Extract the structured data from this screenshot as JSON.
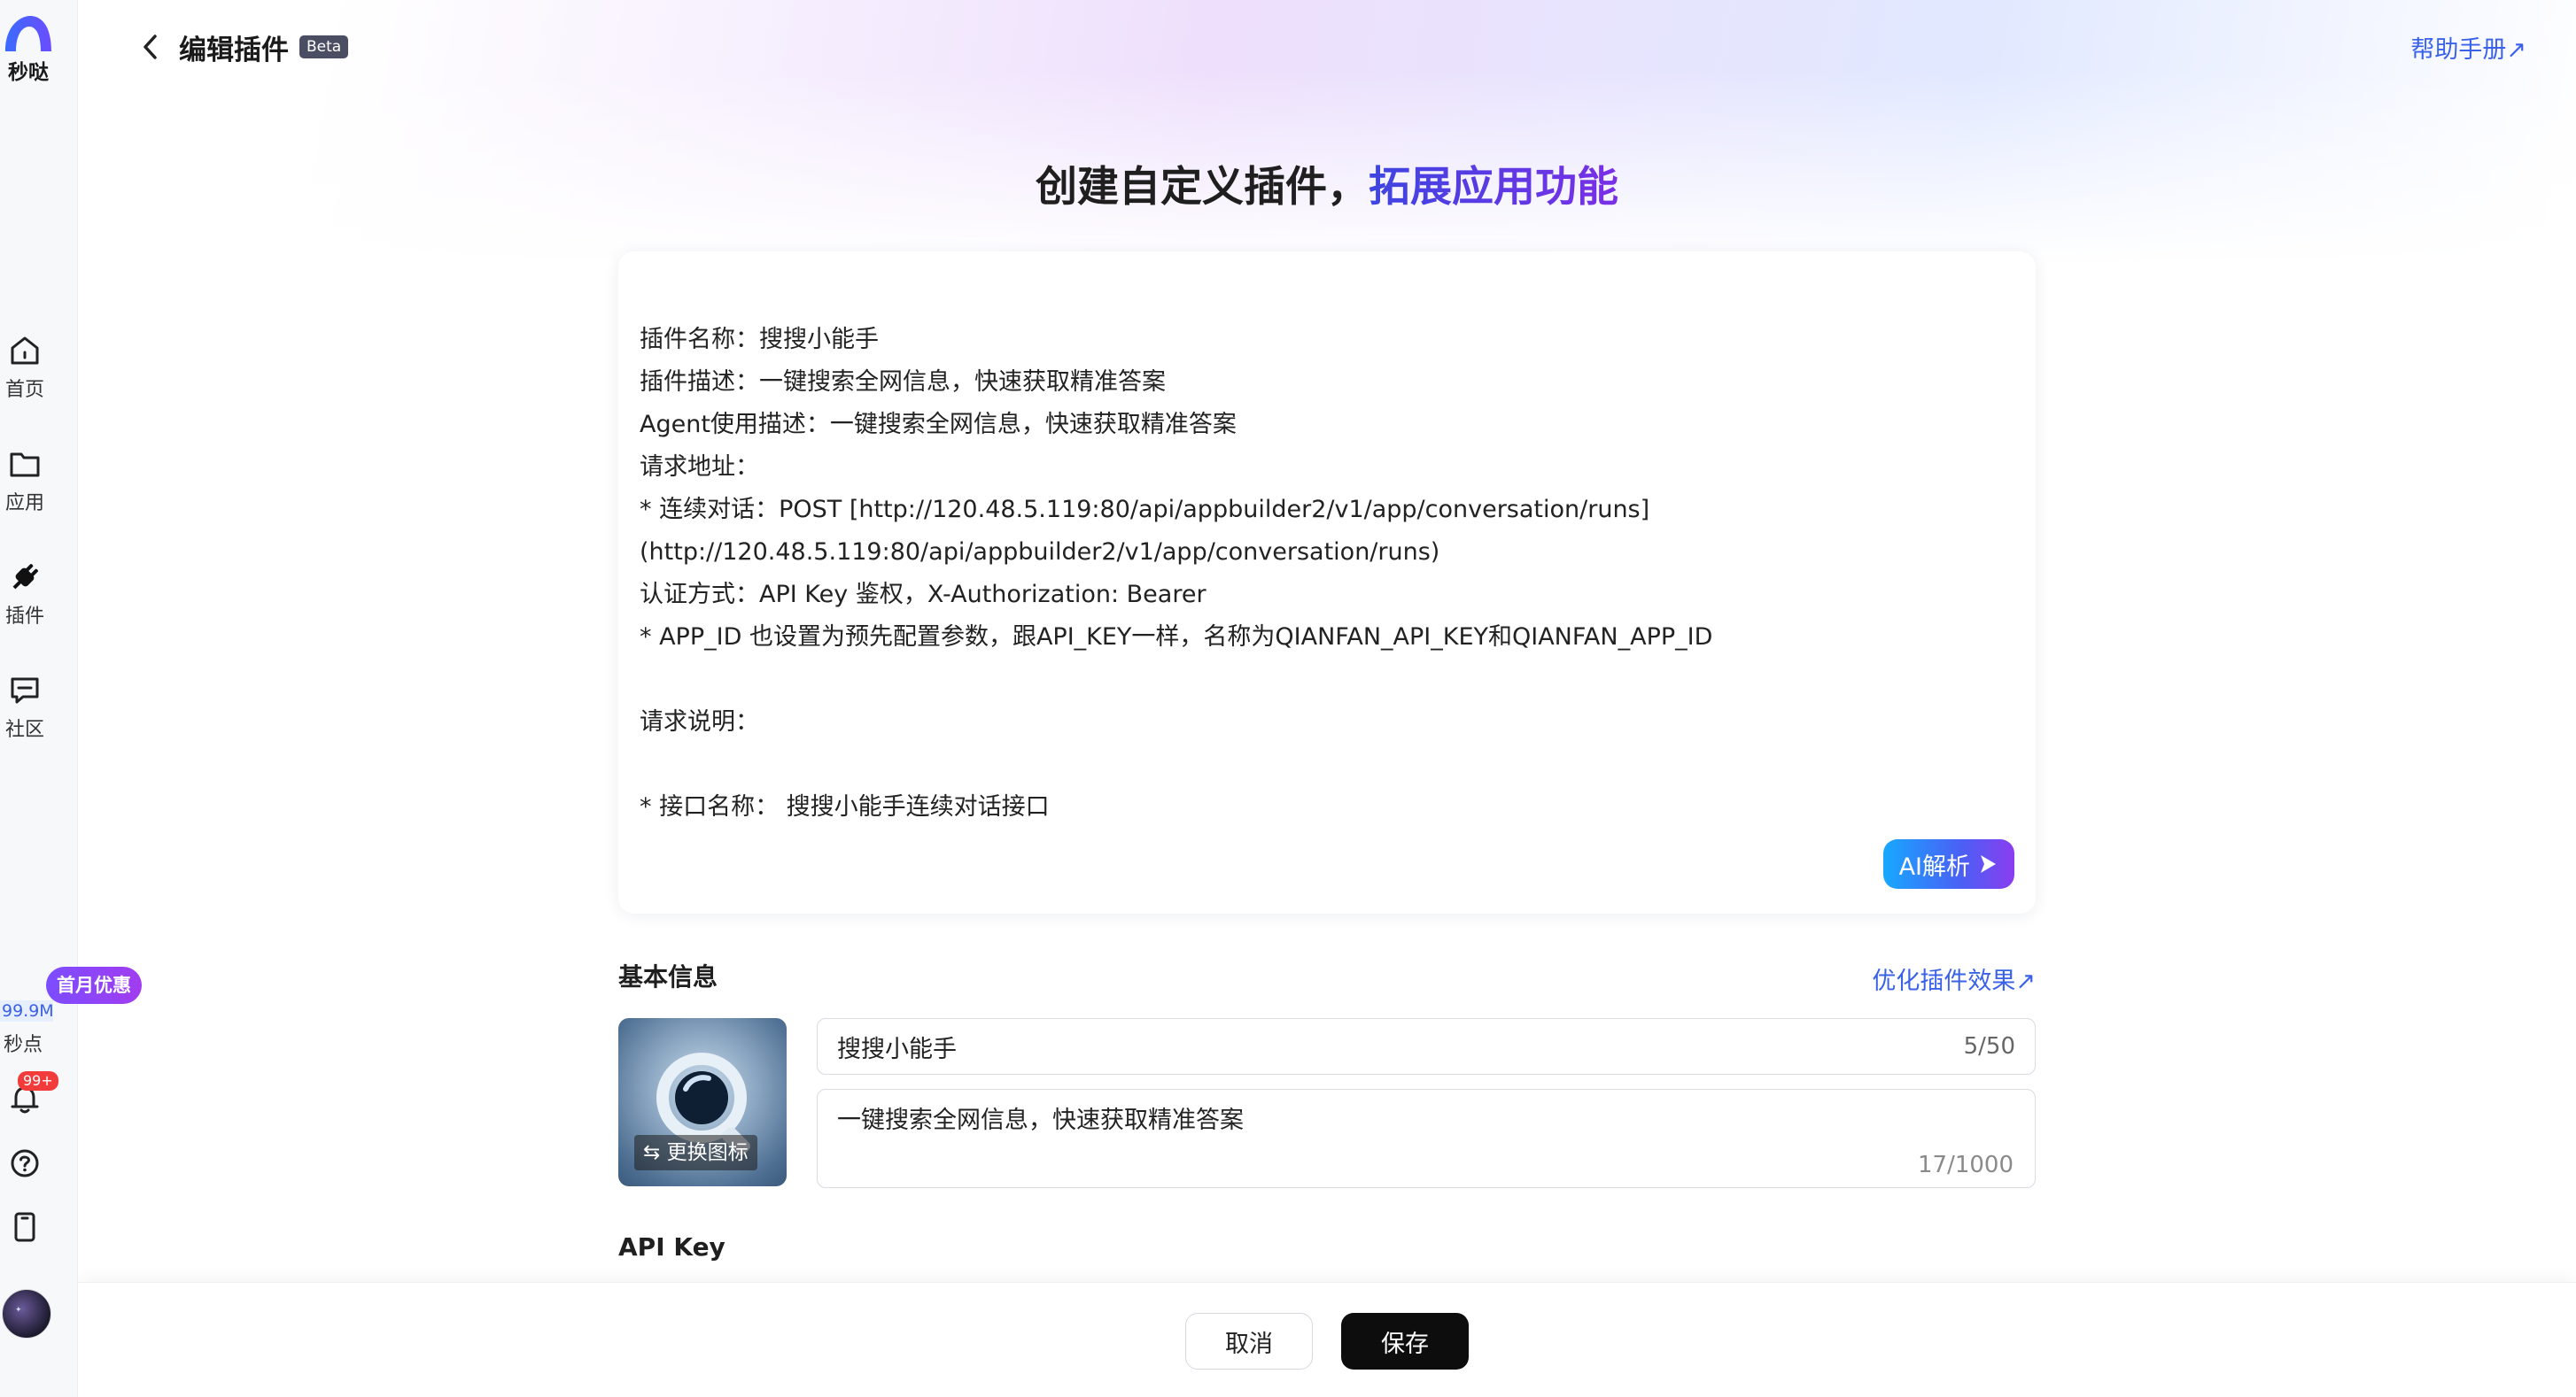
{
  "app": {
    "logo_text": "秒哒"
  },
  "sidebar": {
    "items": [
      {
        "label": "首页",
        "icon": "home-icon"
      },
      {
        "label": "应用",
        "icon": "folder-icon"
      },
      {
        "label": "插件",
        "icon": "plugin-icon"
      },
      {
        "label": "社区",
        "icon": "community-icon"
      }
    ],
    "promo_badge": "首月优惠",
    "points_value": "99.9M",
    "points_label": "秒点",
    "notification_count": "99+"
  },
  "header": {
    "title": "编辑插件",
    "badge": "Beta",
    "help_link": "帮助手册↗"
  },
  "hero": {
    "prefix": "创建自定义插件，",
    "accent": "拓展应用功能"
  },
  "spec_card": {
    "lines": [
      "插件名称：搜搜小能手",
      "插件描述：一键搜索全网信息，快速获取精准答案",
      "Agent使用描述：一键搜索全网信息，快速获取精准答案",
      "请求地址：",
      "* 连续对话：POST [http://120.48.5.119:80/api/appbuilder2/v1/app/conversation/runs]",
      "(http://120.48.5.119:80/api/appbuilder2/v1/app/conversation/runs)",
      "认证方式：API Key 鉴权，X-Authorization: Bearer",
      "* APP_ID 也设置为预先配置参数，跟API_KEY一样，名称为QIANFAN_API_KEY和QIANFAN_APP_ID",
      "",
      "请求说明：",
      "",
      "* 接口名称： 搜搜小能手连续对话接口"
    ],
    "ai_button": "AI解析"
  },
  "basic_info": {
    "title": "基本信息",
    "optimize_link": "优化插件效果↗",
    "change_icon": "⇆ 更换图标",
    "name_value": "搜搜小能手",
    "name_count": "5/50",
    "desc_value": "一键搜索全网信息，快速获取精准答案",
    "desc_count": "17/1000"
  },
  "api_key": {
    "title": "API Key"
  },
  "footer": {
    "cancel": "取消",
    "save": "保存"
  }
}
